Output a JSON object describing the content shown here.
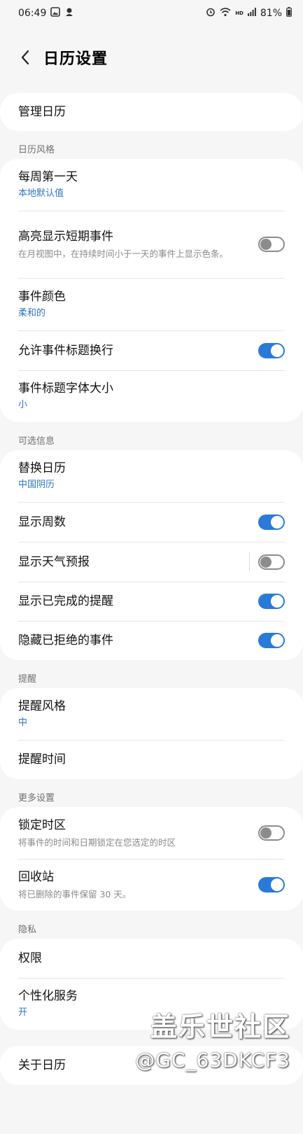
{
  "status_bar": {
    "time": "06:49",
    "left_icons": [
      "image-icon",
      "notification-icon"
    ],
    "right_icons": [
      "alarm-icon",
      "wifi-icon",
      "hd-icon",
      "signal-icon"
    ],
    "hd_label": "HD",
    "battery": "81%"
  },
  "header": {
    "title": "日历设置"
  },
  "manage": {
    "title": "管理日历"
  },
  "sections": {
    "style": "日历风格",
    "optional": "可选信息",
    "reminders": "提醒",
    "more": "更多设置",
    "privacy": "隐私"
  },
  "style_items": {
    "first_day": {
      "title": "每周第一天",
      "value": "本地默认值"
    },
    "highlight": {
      "title": "高亮显示短期事件",
      "desc": "在月视图中，在持续时间小于一天的事件上显示色条。",
      "on": false
    },
    "color": {
      "title": "事件颜色",
      "value": "柔和的"
    },
    "wrap": {
      "title": "允许事件标题换行",
      "on": true
    },
    "font_size": {
      "title": "事件标题字体大小",
      "value": "小"
    }
  },
  "optional_items": {
    "alt_calendar": {
      "title": "替换日历",
      "value": "中国阴历"
    },
    "week_numbers": {
      "title": "显示周数",
      "on": true
    },
    "weather": {
      "title": "显示天气预报",
      "on": false
    },
    "completed_reminders": {
      "title": "显示已完成的提醒",
      "on": true
    },
    "hide_declined": {
      "title": "隐藏已拒绝的事件",
      "on": true
    }
  },
  "reminder_items": {
    "style": {
      "title": "提醒风格",
      "value": "中"
    },
    "time": {
      "title": "提醒时间"
    }
  },
  "more_items": {
    "lock_tz": {
      "title": "锁定时区",
      "desc": "将事件的时间和日期锁定在您选定的时区",
      "on": false
    },
    "trash": {
      "title": "回收站",
      "desc": "将已删除的事件保留 30 天。",
      "on": true
    }
  },
  "privacy_items": {
    "permissions": {
      "title": "权限"
    },
    "personalization": {
      "title": "个性化服务",
      "value": "开"
    }
  },
  "about": {
    "title": "关于日历"
  },
  "watermark": {
    "line1": "盖乐世社区",
    "line2": "@GC_63DKCF3"
  },
  "colors": {
    "accent": "#2a7ad8",
    "link": "#2f76c4",
    "background": "#f6f6f6"
  }
}
